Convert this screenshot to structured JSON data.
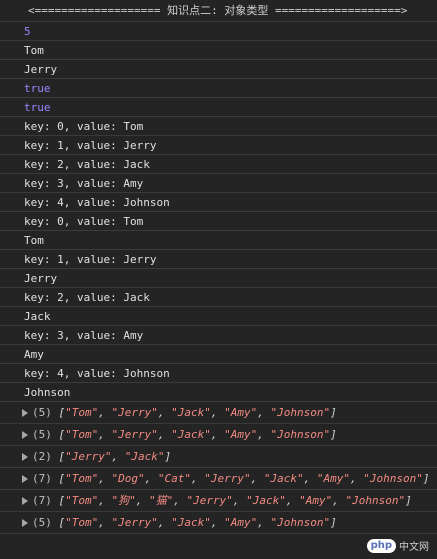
{
  "header": "<=================== 知识点二: 对象类型 ===================>",
  "logs": [
    {
      "text": "5",
      "kind": "num"
    },
    {
      "text": "Tom",
      "kind": "str"
    },
    {
      "text": "Jerry",
      "kind": "str"
    },
    {
      "text": "true",
      "kind": "bool"
    },
    {
      "text": "true",
      "kind": "bool"
    },
    {
      "text": "key: 0, value: Tom",
      "kind": "str"
    },
    {
      "text": "key: 1, value: Jerry",
      "kind": "str"
    },
    {
      "text": "key: 2, value: Jack",
      "kind": "str"
    },
    {
      "text": "key: 3, value: Amy",
      "kind": "str"
    },
    {
      "text": "key: 4, value: Johnson",
      "kind": "str"
    },
    {
      "text": "key: 0, value: Tom",
      "kind": "str"
    },
    {
      "text": "Tom",
      "kind": "str"
    },
    {
      "text": "key: 1, value: Jerry",
      "kind": "str"
    },
    {
      "text": "Jerry",
      "kind": "str"
    },
    {
      "text": "key: 2, value: Jack",
      "kind": "str"
    },
    {
      "text": "Jack",
      "kind": "str"
    },
    {
      "text": "key: 3, value: Amy",
      "kind": "str"
    },
    {
      "text": "Amy",
      "kind": "str"
    },
    {
      "text": "key: 4, value: Johnson",
      "kind": "str"
    },
    {
      "text": "Johnson",
      "kind": "str"
    }
  ],
  "arrays": [
    {
      "count": "(5)",
      "items": [
        "Tom",
        "Jerry",
        "Jack",
        "Amy",
        "Johnson"
      ]
    },
    {
      "count": "(5)",
      "items": [
        "Tom",
        "Jerry",
        "Jack",
        "Amy",
        "Johnson"
      ]
    },
    {
      "count": "(2)",
      "items": [
        "Jerry",
        "Jack"
      ]
    },
    {
      "count": "(7)",
      "items": [
        "Tom",
        "Dog",
        "Cat",
        "Jerry",
        "Jack",
        "Amy",
        "Johnson"
      ]
    },
    {
      "count": "(7)",
      "items": [
        "Tom",
        "狗",
        "猫",
        "Jerry",
        "Jack",
        "Amy",
        "Johnson"
      ]
    },
    {
      "count": "(5)",
      "items": [
        "Tom",
        "Jerry",
        "Jack",
        "Amy",
        "Johnson"
      ]
    }
  ],
  "watermark": {
    "logo": "php",
    "text": "中文网"
  },
  "colors": {
    "background": "#242424",
    "number": "#9a86fd",
    "string_item": "#f28b82",
    "text": "#d5d5d5"
  }
}
